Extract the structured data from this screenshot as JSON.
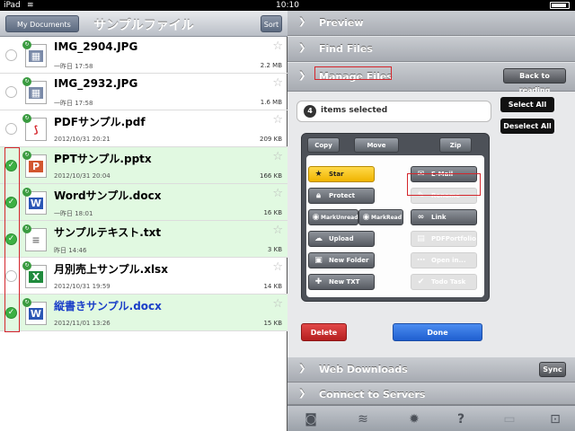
{
  "status_bar": {
    "device": "iPad",
    "wifi_icon": "wifi-icon",
    "time": "10:10"
  },
  "left_nav": {
    "back_label": "My Documents",
    "title": "サンプルファイル",
    "sort_label": "Sort"
  },
  "files": [
    {
      "name": "IMG_2904.JPG",
      "date": "一昨日 17:58",
      "size": "2.2 MB",
      "selected": false,
      "icon": "image-file-icon"
    },
    {
      "name": "IMG_2932.JPG",
      "date": "一昨日 17:58",
      "size": "1.6 MB",
      "selected": false,
      "icon": "image-file-icon"
    },
    {
      "name": "PDFサンプル.pdf",
      "date": "2012/10/31 20:21",
      "size": "209 KB",
      "selected": false,
      "icon": "pdf-file-icon"
    },
    {
      "name": "PPTサンプル.pptx",
      "date": "2012/10/31 20:04",
      "size": "166 KB",
      "selected": true,
      "icon": "ppt-file-icon"
    },
    {
      "name": "Wordサンプル.docx",
      "date": "一昨日 18:01",
      "size": "16 KB",
      "selected": true,
      "icon": "word-file-icon"
    },
    {
      "name": "サンプルテキスト.txt",
      "date": "昨日 14:46",
      "size": "3 KB",
      "selected": true,
      "icon": "text-file-icon"
    },
    {
      "name": "月別売上サンプル.xlsx",
      "date": "2012/10/31 19:59",
      "size": "14 KB",
      "selected": false,
      "icon": "excel-file-icon"
    },
    {
      "name": "縦書きサンプル.docx",
      "date": "2012/11/01 13:26",
      "size": "15 KB",
      "selected": true,
      "icon": "word-file-icon"
    }
  ],
  "right": {
    "preview": "Preview",
    "find_files": "Find Files",
    "manage_files": "Manage Files",
    "back_to_reading": "Back to reading",
    "selected_count": "4",
    "items_selected": "items selected",
    "select_all": "Select All",
    "deselect_all": "Deselect All",
    "copy": "Copy",
    "move": "Move",
    "zip": "Zip",
    "actions": {
      "star": "Star",
      "email": "E-Mail",
      "protect": "Protect",
      "rename": "Rename",
      "mark_unread": "MarkUnread",
      "mark_read": "MarkRead",
      "link": "Link",
      "upload": "Upload",
      "pdf_portfolio": "PDFPortfolio",
      "new_folder": "New Folder",
      "open_in": "Open in...",
      "new_txt": "New TXT",
      "todo_task": "Todo Task"
    },
    "delete": "Delete",
    "done": "Done",
    "web_downloads": "Web Downloads",
    "sync": "Sync",
    "connect_servers": "Connect to Servers"
  },
  "colors": {
    "selected_row": "#e1f9e1",
    "highlight_red": "#d4262c",
    "delete_red": "#c62a2a",
    "done_blue": "#2f6fe0",
    "star_yellow": "#f5c400"
  }
}
